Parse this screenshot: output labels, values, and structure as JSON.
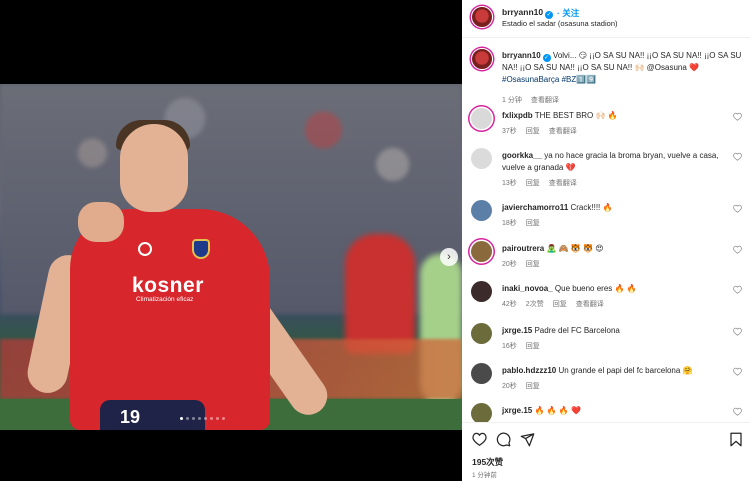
{
  "post": {
    "username": "brryann10",
    "follow_label": "关注",
    "location": "Estadio el sadar (osasuna stadion)",
    "sponsor_text": "kosner",
    "sponsor_sub": "Climatización eficaz",
    "shirt_number": "19",
    "carousel_dots": 8,
    "carousel_active": 0
  },
  "caption": {
    "username": "brryann10",
    "text": "Volvi... 😏 ¡¡O SA SU NA!! ¡¡O SA SU NA!! ¡¡O SA SU NA!! ¡¡O SA SU NA!! ¡¡O SA SU NA!! 🙌🏻 @Osasuna ❤️",
    "hashtags": "#OsasunaBarça #BZ1️⃣9️⃣",
    "time": "1 分钟",
    "translate": "查看翻译"
  },
  "comments": [
    {
      "username": "fxlixpdb",
      "text": "THE BEST BRO 🙌🏻 🔥",
      "time": "37秒",
      "reply": "回复",
      "translate": "查看翻译",
      "avatar_color": "#d9d9d9",
      "story_ring": true
    },
    {
      "username": "goorkka__",
      "text": "ya no hace gracia la broma bryan, vuelve a casa, vuelve a granada 💔",
      "time": "13秒",
      "reply": "回复",
      "translate": "查看翻译",
      "avatar_color": "#dbdbdb",
      "story_ring": false
    },
    {
      "username": "javierchamorro11",
      "text": "Crack!!!! 🔥",
      "time": "18秒",
      "reply": "回复",
      "translate": "",
      "avatar_color": "#5b7fa6",
      "story_ring": false
    },
    {
      "username": "pairoutrera",
      "text": "🧟‍♂️ 🙈 🐯 🐯 😍",
      "time": "20秒",
      "reply": "回复",
      "translate": "",
      "avatar_color": "#8a6a3c",
      "story_ring": true
    },
    {
      "username": "inaki_novoa_",
      "text": "Que bueno eres 🔥 🔥",
      "time": "42秒",
      "reply": "回复",
      "likes": "2次赞",
      "translate": "查看翻译",
      "avatar_color": "#3b2b2b",
      "story_ring": false
    },
    {
      "username": "jxrge.15",
      "text": "Padre del FC Barcelona",
      "time": "16秒",
      "reply": "回复",
      "translate": "",
      "avatar_color": "#6b6b3b",
      "story_ring": false
    },
    {
      "username": "pablo.hdzzz10",
      "text": "Un grande el papi del fc barcelona 🤗",
      "time": "20秒",
      "reply": "回复",
      "translate": "",
      "avatar_color": "#4a4a4a",
      "story_ring": false
    },
    {
      "username": "jxrge.15",
      "text": "🔥 🔥 🔥 ❤️",
      "time": "",
      "reply": "",
      "translate": "",
      "avatar_color": "#6b6b3b",
      "story_ring": false
    }
  ],
  "actions": {
    "likes": "195次赞",
    "time": "1 分钟前"
  },
  "icons": [
    "heart-icon",
    "comment-icon",
    "share-icon",
    "bookmark-icon",
    "chevron-right-icon",
    "verified-icon"
  ]
}
